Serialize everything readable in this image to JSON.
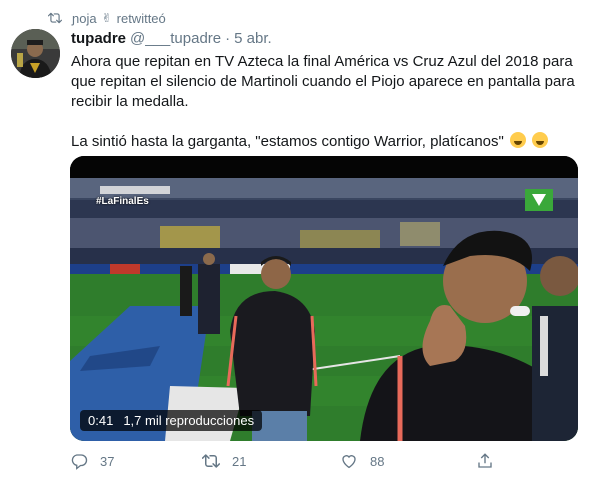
{
  "retweet_bar": {
    "user": "ɲoja",
    "emoji": "✌",
    "action": "retwitteó"
  },
  "tweet": {
    "name": "tupadre",
    "handle": "@___tupadre",
    "separator": "·",
    "date": "5 abr.",
    "text_paragraph_1": "Ahora que repitan en TV Azteca la final América vs Cruz Azul del 2018 para que repitan el silencio de Martinoli cuando el Piojo aparece en pantalla para recibir la medalla.",
    "text_paragraph_2": "La sintió hasta la garganta, \"estamos contigo Warrior, platícanos\""
  },
  "media": {
    "hashtag_overlay": "#LaFinalEs",
    "duration": "0:41",
    "views": "1,7 mil reproducciones"
  },
  "actions": {
    "replies": "37",
    "retweets": "21",
    "likes": "88"
  },
  "colors": {
    "secondary_text": "#657786",
    "primary_text": "#14171a",
    "pitch_green": "#2f7d2c"
  }
}
